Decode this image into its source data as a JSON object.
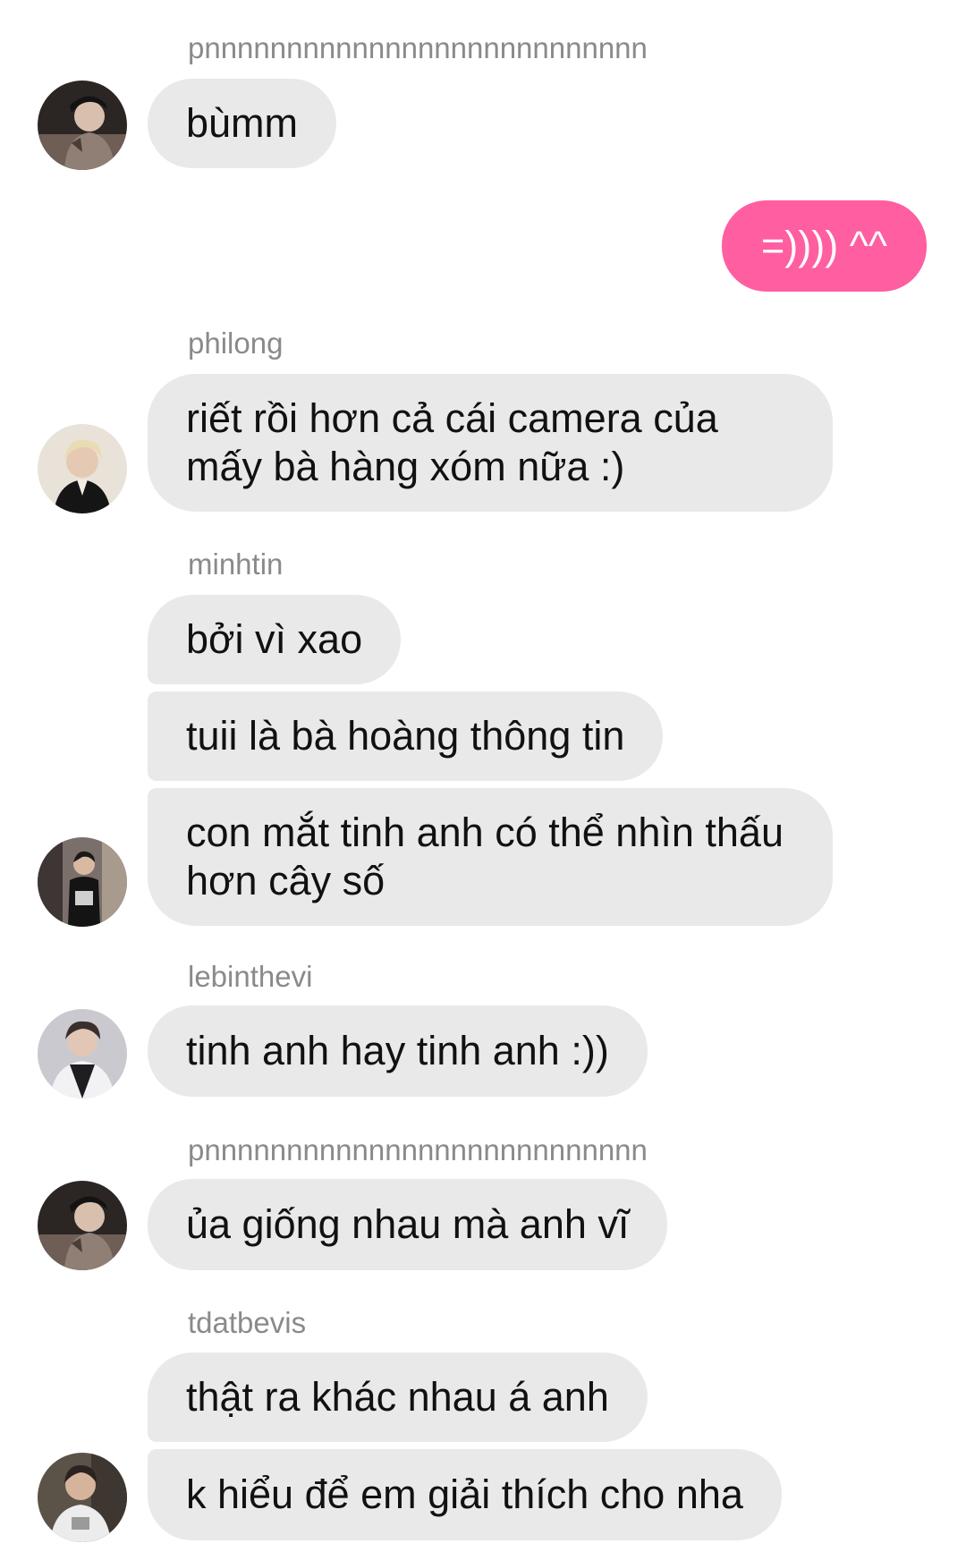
{
  "chat": {
    "messages": [
      {
        "sender": "pnnnnnnnnnnnnnnnnnnnnnnnnnnn",
        "texts": [
          "bùmm"
        ]
      },
      {
        "sender": "me",
        "texts": [
          "=)))) ^^"
        ]
      },
      {
        "sender": "philong",
        "texts": [
          "riết rồi hơn cả cái camera của mấy bà hàng xóm nữa :)"
        ]
      },
      {
        "sender": "minhtin",
        "texts": [
          "bởi vì xao",
          "tuii là bà hoàng thông tin",
          "con mắt tinh anh có thể nhìn thấu hơn cây số"
        ]
      },
      {
        "sender": "lebinthevi",
        "texts": [
          "tinh anh hay tinh anh :))"
        ]
      },
      {
        "sender": "pnnnnnnnnnnnnnnnnnnnnnnnnnnn",
        "texts": [
          "ủa giống nhau mà anh vĩ"
        ]
      },
      {
        "sender": "tdatbevis",
        "texts": [
          "thật ra khác nhau á anh",
          "k hiểu để em giải thích cho nha"
        ]
      }
    ]
  },
  "colors": {
    "incoming_bubble": "#e9e9e9",
    "outgoing_bubble": "#ff5ea0",
    "sender_name": "#8a8a8a"
  },
  "icons": {
    "avatar": "user-avatar-photo"
  }
}
